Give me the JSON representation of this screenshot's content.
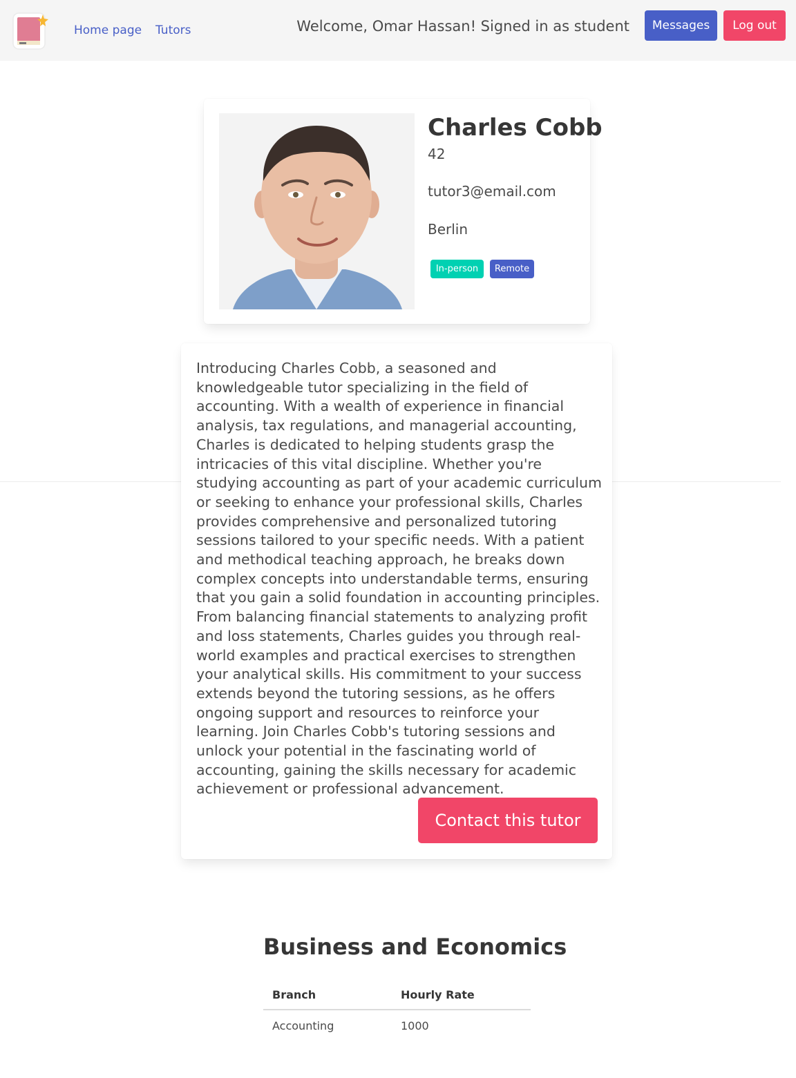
{
  "nav": {
    "home_label": "Home page",
    "tutors_label": "Tutors",
    "welcome_text": "Welcome, Omar Hassan! Signed in as student",
    "messages_label": "Messages",
    "logout_label": "Log out"
  },
  "colors": {
    "primary": "#485fc7",
    "danger": "#f14668",
    "success": "#00d1b2"
  },
  "profile": {
    "name": "Charles Cobb",
    "age": "42",
    "email": "tutor3@email.com",
    "city": "Berlin",
    "tags": [
      "In-person",
      "Remote"
    ]
  },
  "description": {
    "text": "Introducing Charles Cobb, a seasoned and knowledgeable tutor specializing in the field of accounting. With a wealth of experience in financial analysis, tax regulations, and managerial accounting, Charles is dedicated to helping students grasp the intricacies of this vital discipline. Whether you're studying accounting as part of your academic curriculum or seeking to enhance your professional skills, Charles provides comprehensive and personalized tutoring sessions tailored to your specific needs. With a patient and methodical teaching approach, he breaks down complex concepts into understandable terms, ensuring that you gain a solid foundation in accounting principles. From balancing financial statements to analyzing profit and loss statements, Charles guides you through real-world examples and practical exercises to strengthen your analytical skills. His commitment to your success extends beyond the tutoring sessions, as he offers ongoing support and resources to reinforce your learning. Join Charles Cobb's tutoring sessions and unlock your potential in the fascinating world of accounting, gaining the skills necessary for academic achievement or professional advancement.",
    "contact_label": "Contact this tutor"
  },
  "subject": {
    "title": "Business and Economics",
    "columns": [
      "Branch",
      "Hourly Rate"
    ],
    "rows": [
      [
        "Accounting",
        "1000"
      ]
    ]
  }
}
